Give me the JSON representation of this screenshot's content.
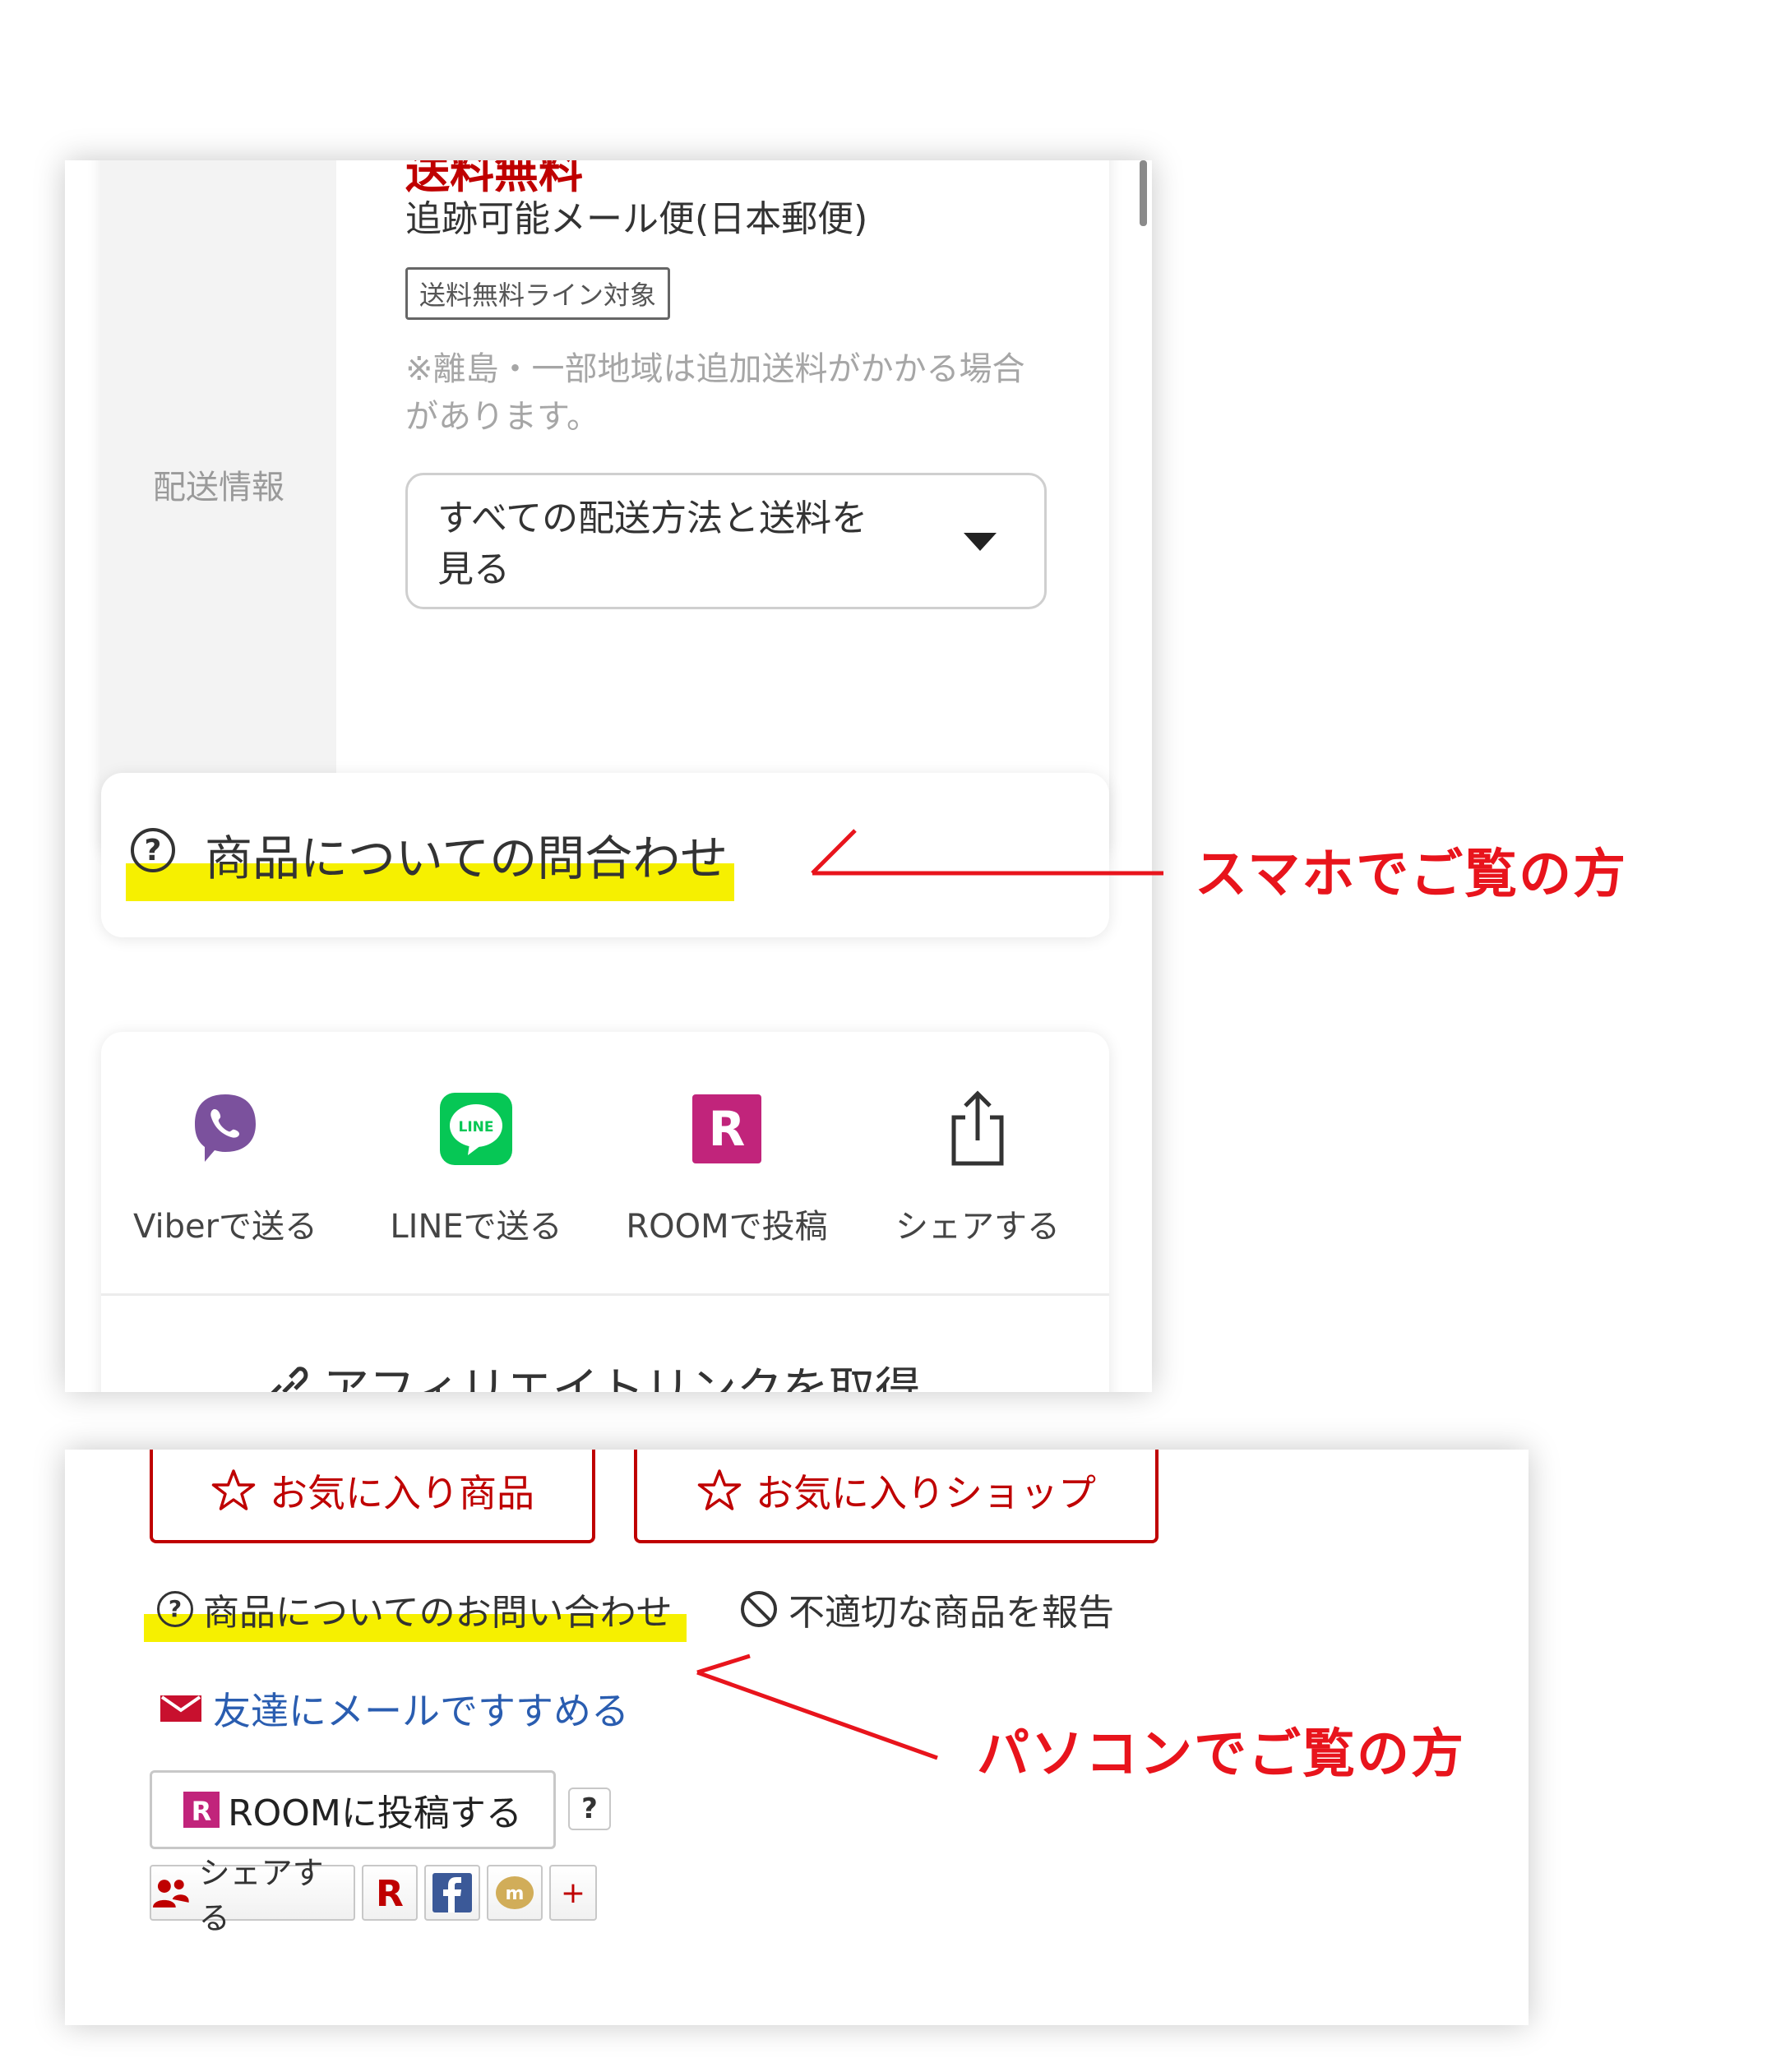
{
  "mobile": {
    "shipping": {
      "label": "配送情報",
      "free_shipping": "送料無料",
      "method": "追跡可能メール便(日本郵便)",
      "badge": "送料無料ライン対象",
      "note": "※離島・一部地域は追加送料がかかる場合があります。",
      "toggle_label": "すべての配送方法と送料を見る"
    },
    "inquiry": {
      "icon": "question-circle-icon",
      "label": "商品についての問合わせ"
    },
    "share": {
      "items": [
        {
          "label": "Viberで送る",
          "icon": "viber-icon"
        },
        {
          "label": "LINEで送る",
          "icon": "line-icon"
        },
        {
          "label": "ROOMで投稿",
          "icon": "room-icon"
        },
        {
          "label": "シェアする",
          "icon": "share-icon"
        }
      ]
    },
    "affiliate": {
      "label": "アフィリエイトリンクを取得",
      "icon": "link-icon"
    }
  },
  "desktop": {
    "favorites": {
      "item_label": "お気に入り商品",
      "shop_label": "お気に入りショップ"
    },
    "inquiry_label": "商品についてのお問い合わせ",
    "report_label": "不適切な商品を報告",
    "mail_label": "友達にメールですすめる",
    "room_button_label": "ROOMに投稿する",
    "room_help": "?",
    "share_label": "シェアする",
    "plus": "+"
  },
  "annotations": {
    "smartphone": "スマホでご覧の方",
    "pc": "パソコンでご覧の方",
    "color": "#e8141c",
    "highlight_color": "#f6f000"
  },
  "colors": {
    "rakuten_red": "#bf0000",
    "link_blue": "#2a5db0"
  }
}
